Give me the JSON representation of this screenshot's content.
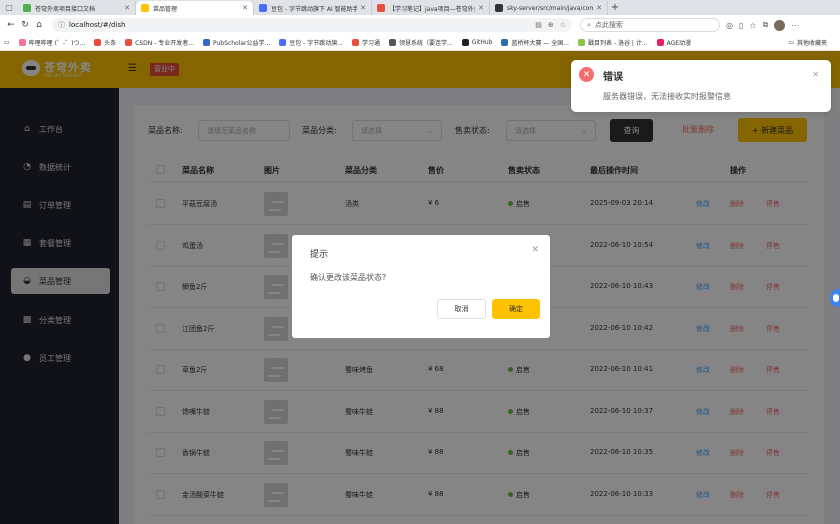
{
  "browser": {
    "tabs": [
      {
        "title": "苍穹外卖项目接口文档",
        "fav_color": "#4caf50",
        "active": false
      },
      {
        "title": "菜品管理",
        "fav_color": "#ffc200",
        "active": true
      },
      {
        "title": "豆包 - 字节跳动旗下 AI 智能助手",
        "fav_color": "#4a6cf7",
        "active": false
      },
      {
        "title": "【学习笔记】java项目—苍穹外卖",
        "fav_color": "#e94e3c",
        "active": false
      },
      {
        "title": "sky-server/src/main/java/com/sky",
        "fav_color": "#333333",
        "active": false
      }
    ],
    "url": "localhost/#/dish",
    "search_placeholder": "点此搜索",
    "bookmarks": [
      {
        "label": "哔哩哔哩 (゜-゜)つ...",
        "color": "#fb7299"
      },
      {
        "label": "头条",
        "color": "#e94e3c"
      },
      {
        "label": "CSDN - 专业开发者...",
        "color": "#e94e3c"
      },
      {
        "label": "PubScholar公益学...",
        "color": "#3366cc"
      },
      {
        "label": "豆包 - 字节跳动旗...",
        "color": "#4a6cf7"
      },
      {
        "label": "学习通",
        "color": "#e94e3c"
      },
      {
        "label": "领慧系统（要连学...",
        "color": "#555555"
      },
      {
        "label": "GitHub",
        "color": "#222222"
      },
      {
        "label": "蓝桥杯大赛 — 全国...",
        "color": "#2b6cb0"
      },
      {
        "label": "戳目列表 - 洛谷 | 计...",
        "color": "#8bc34a"
      },
      {
        "label": "AGE动漫",
        "color": "#e91e63"
      }
    ],
    "bookmarks_other": "其他收藏夹"
  },
  "header": {
    "brand": "苍穹外卖",
    "brand_sub": "THE SKY TAKE-OUT",
    "status": "营业中"
  },
  "sidebar": {
    "items": [
      {
        "label": "工作台",
        "icon": "home-icon",
        "glyph": "⌂"
      },
      {
        "label": "数据统计",
        "icon": "chart-icon",
        "glyph": "◔"
      },
      {
        "label": "订单管理",
        "icon": "order-icon",
        "glyph": "▤"
      },
      {
        "label": "套餐管理",
        "icon": "combo-icon",
        "glyph": "▦"
      },
      {
        "label": "菜品管理",
        "icon": "dish-icon",
        "glyph": "◒",
        "active": true
      },
      {
        "label": "分类管理",
        "icon": "category-icon",
        "glyph": "▩"
      },
      {
        "label": "员工管理",
        "icon": "employee-icon",
        "glyph": "●"
      }
    ]
  },
  "filters": {
    "name_label": "菜品名称:",
    "name_placeholder": "请填写菜品名称",
    "category_label": "菜品分类:",
    "category_placeholder": "请选择",
    "status_label": "售卖状态:",
    "status_placeholder": "请选择",
    "query_btn": "查询",
    "batch_delete": "批量删除",
    "new_btn": "+ 新建菜品"
  },
  "table": {
    "columns": [
      "菜品名称",
      "图片",
      "菜品分类",
      "售价",
      "售卖状态",
      "最后操作时间",
      "操作"
    ],
    "op_edit": "修改",
    "op_delete": "删除",
    "op_stop": "停售",
    "rows": [
      {
        "name": "平菇豆腐汤",
        "category": "汤类",
        "price": "¥ 6",
        "status": "启售",
        "time": "2025-09-03 20:14"
      },
      {
        "name": "鸡蛋汤",
        "category": "",
        "price": "",
        "status": "",
        "time": "2022-06-10 10:54"
      },
      {
        "name": "鲫鱼2斤",
        "category": "",
        "price": "",
        "status": "",
        "time": "2022-06-10 10:43"
      },
      {
        "name": "江团鱼2斤",
        "category": "",
        "price": "",
        "status": "",
        "time": "2022-06-10 10:42"
      },
      {
        "name": "草鱼2斤",
        "category": "蜀味烤鱼",
        "price": "¥ 68",
        "status": "启售",
        "time": "2022-06-10 10:41"
      },
      {
        "name": "馋嘴牛蛙",
        "category": "蜀味牛蛙",
        "price": "¥ 88",
        "status": "启售",
        "time": "2022-06-10 10:37"
      },
      {
        "name": "香锅牛蛙",
        "category": "蜀味牛蛙",
        "price": "¥ 88",
        "status": "启售",
        "time": "2022-06-10 10:35"
      },
      {
        "name": "金汤酸菜牛蛙",
        "category": "蜀味牛蛙",
        "price": "¥ 88",
        "status": "启售",
        "time": "2022-06-10 10:33"
      }
    ]
  },
  "dialog": {
    "title": "提示",
    "message": "确认更改该菜品状态?",
    "cancel": "取消",
    "confirm": "确定"
  },
  "toast": {
    "title": "错误",
    "message": "服务器错误，无法接收实时报警信息"
  },
  "colors": {
    "brand": "#ffc200",
    "sidebar": "#22242e",
    "danger": "#f56c6c",
    "link": "#409eff",
    "success": "#67c23a"
  }
}
